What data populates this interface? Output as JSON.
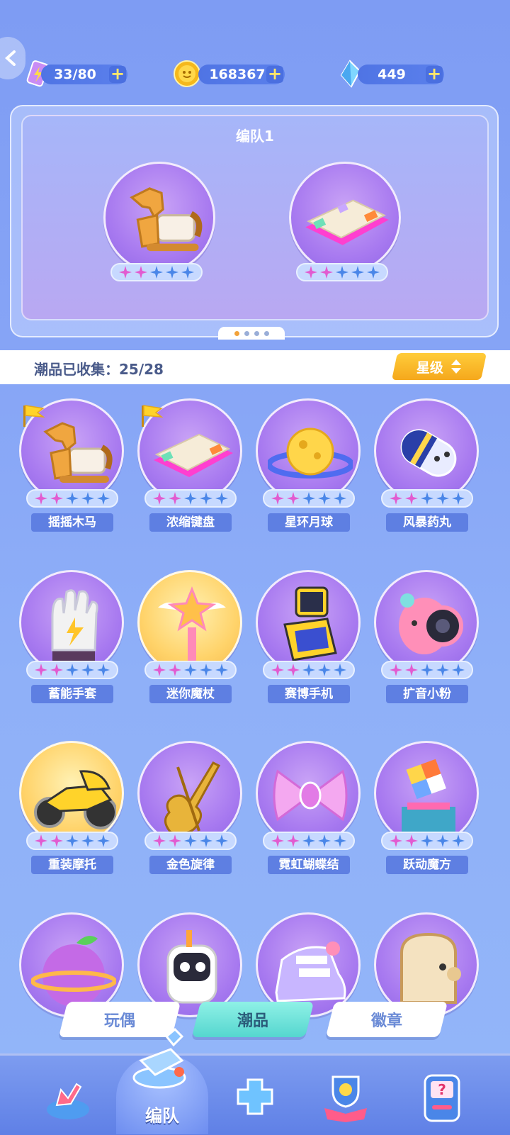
{
  "resources": {
    "energy": {
      "value": "33/80",
      "icon": "energy-ticket-icon"
    },
    "coins": {
      "value": "168367",
      "icon": "gold-coin-icon"
    },
    "gems": {
      "value": "449",
      "icon": "blue-crystal-icon"
    },
    "plus_label": "+"
  },
  "team": {
    "title": "编队1",
    "slots": [
      {
        "name": "rocking-horse",
        "stars_filled": 2,
        "stars_total": 5
      },
      {
        "name": "keyboard",
        "stars_filled": 2,
        "stars_total": 5
      }
    ],
    "page_dots": 4,
    "active_page": 1
  },
  "collection": {
    "label": "潮品已收集：25/28",
    "sort_label": "星级"
  },
  "items": [
    {
      "name": "摇摇木马",
      "stars_filled": 2,
      "equipped": true,
      "art": "horse"
    },
    {
      "name": "浓缩键盘",
      "stars_filled": 2,
      "equipped": true,
      "art": "keyboard"
    },
    {
      "name": "星环月球",
      "stars_filled": 2,
      "equipped": false,
      "art": "planet"
    },
    {
      "name": "风暴药丸",
      "stars_filled": 2,
      "equipped": false,
      "art": "pill"
    },
    {
      "name": "蓄能手套",
      "stars_filled": 2,
      "equipped": false,
      "art": "glove"
    },
    {
      "name": "迷你魔杖",
      "stars_filled": 2,
      "equipped": false,
      "art": "wand",
      "gold": true
    },
    {
      "name": "赛博手机",
      "stars_filled": 2,
      "equipped": false,
      "art": "phone"
    },
    {
      "name": "扩音小粉",
      "stars_filled": 2,
      "equipped": false,
      "art": "speaker"
    },
    {
      "name": "重装摩托",
      "stars_filled": 2,
      "equipped": false,
      "art": "moto",
      "gold": true
    },
    {
      "name": "金色旋律",
      "stars_filled": 2,
      "equipped": false,
      "art": "violin"
    },
    {
      "name": "霓虹蝴蝶结",
      "stars_filled": 2,
      "equipped": false,
      "art": "bow"
    },
    {
      "name": "跃动魔方",
      "stars_filled": 2,
      "equipped": false,
      "art": "cube"
    },
    {
      "name": "",
      "stars_filled": 0,
      "equipped": false,
      "art": "fruit"
    },
    {
      "name": "",
      "stars_filled": 0,
      "equipped": false,
      "art": "robot"
    },
    {
      "name": "",
      "stars_filled": 0,
      "equipped": false,
      "art": "shoe"
    },
    {
      "name": "",
      "stars_filled": 0,
      "equipped": false,
      "art": "toast"
    }
  ],
  "tabs": {
    "toys": "玩偶",
    "trendy": "潮品",
    "badges": "徽章",
    "active": "trendy"
  },
  "nav": {
    "active_label": "编队",
    "buttons": [
      "home-arrow-icon",
      "team-whistle-icon",
      "puzzle-icon",
      "trophy-icon",
      "mystery-box-icon"
    ]
  },
  "colors": {
    "accent_yellow": "#f5a81c",
    "star_pink": "#e25bd0",
    "star_blue": "#4a86e8",
    "panel_purple": "#a87af0"
  }
}
